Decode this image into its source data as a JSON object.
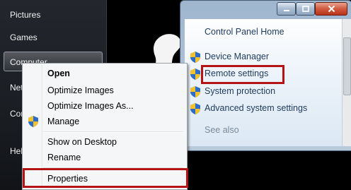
{
  "start_menu": {
    "items": [
      {
        "label": "Pictures"
      },
      {
        "label": "Games"
      },
      {
        "label": "Computer"
      },
      {
        "label": "Net"
      },
      {
        "label": "Con"
      },
      {
        "label": "Hel"
      }
    ]
  },
  "system_window": {
    "control_panel_home": "Control Panel Home",
    "links": [
      {
        "label": "Device Manager",
        "icon": "uac-shield-icon"
      },
      {
        "label": "Remote settings",
        "icon": "uac-shield-icon"
      },
      {
        "label": "System protection",
        "icon": "uac-shield-icon"
      },
      {
        "label": "Advanced system settings",
        "icon": "uac-shield-icon"
      }
    ],
    "see_also": "See also",
    "caption_buttons": {
      "minimize": "minimize-icon",
      "maximize": "maximize-icon",
      "close": "close-icon"
    }
  },
  "context_menu": {
    "items": [
      {
        "label": "Open",
        "bold": true
      },
      {
        "label": "Optimize Images"
      },
      {
        "label": "Optimize Images As..."
      },
      {
        "label": "Manage",
        "icon": "uac-shield-icon"
      },
      {
        "label": "Show on Desktop"
      },
      {
        "label": "Rename"
      },
      {
        "label": "Properties"
      }
    ]
  },
  "highlight_color": "#b51417"
}
